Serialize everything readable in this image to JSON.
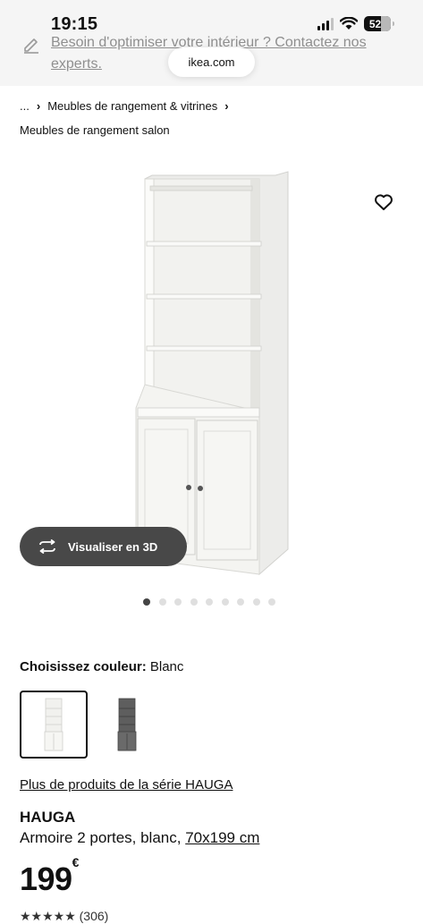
{
  "status_bar": {
    "time": "19:15",
    "battery": "52"
  },
  "banner": {
    "text": "Besoin d'optimiser votre intérieur ? Contactez nos experts."
  },
  "browser": {
    "url": "ikea.com"
  },
  "breadcrumb": {
    "ellipsis": "...",
    "item1": "Meubles de rangement & vitrines",
    "item2": "Meubles de rangement salon"
  },
  "gallery": {
    "visualize_label": "Visualiser en 3D",
    "dot_count": 9,
    "active_index": 0
  },
  "color": {
    "label": "Choisissez couleur:",
    "selected": "Blanc"
  },
  "series_link": "Plus de produits de la série HAUGA",
  "product": {
    "name": "HAUGA",
    "description": "Armoire 2 portes, blanc, ",
    "dimensions": "70x199 cm",
    "price": "199",
    "currency": "€"
  },
  "cutoff_text": "★★★★★ (306)",
  "icons": [
    "edit-icon",
    "heart-icon",
    "rotate-3d-icon",
    "signal-icon",
    "wifi-icon",
    "battery-icon"
  ],
  "colors": {
    "banner_bg": "#f5f5f5",
    "button_bg": "#484848",
    "dot_active": "#444444",
    "dot_inactive": "#dfdfdf"
  }
}
